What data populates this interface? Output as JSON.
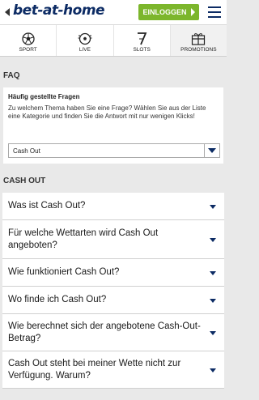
{
  "header": {
    "logo": "bet-at-home",
    "login_label": "EINLOGGEN"
  },
  "nav": [
    {
      "label": "SPORT",
      "icon": "soccer-ball-icon"
    },
    {
      "label": "LIVE",
      "icon": "live-ball-icon"
    },
    {
      "label": "SLOTS",
      "icon": "slots-seven-icon"
    },
    {
      "label": "PROMOTIONS",
      "icon": "promotions-gift-icon"
    }
  ],
  "faq": {
    "section_title": "FAQ",
    "heading": "Häufig gestellte Fragen",
    "text": "Zu welchem Thema haben Sie eine Frage? Wählen Sie aus der Liste eine Kategorie und finden Sie die Antwort mit nur wenigen Klicks!",
    "selected_category": "Cash Out"
  },
  "cashout": {
    "section_title": "CASH OUT",
    "questions": [
      "Was ist Cash Out?",
      "Für welche Wettarten wird Cash Out angeboten?",
      "Wie funktioniert Cash Out?",
      "Wo finde ich Cash Out?",
      "Wie berechnet sich der angebotene Cash-Out-Betrag?",
      "Cash Out steht bei meiner Wette nicht zur Verfügung. Warum?"
    ]
  },
  "colors": {
    "brand_navy": "#0c2b64",
    "login_green": "#7cb62c",
    "page_background": "#e9e9e9"
  }
}
